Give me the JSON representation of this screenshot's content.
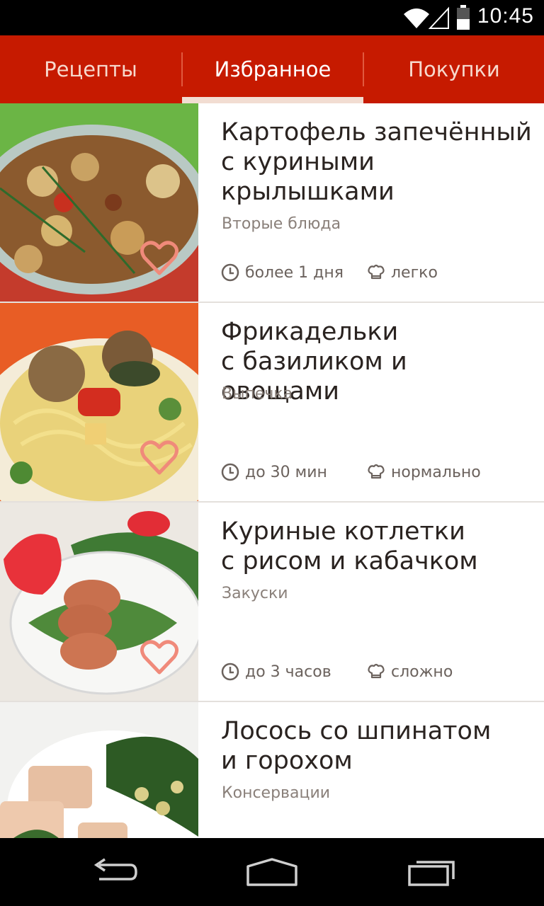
{
  "status": {
    "time": "10:45"
  },
  "tabs": [
    {
      "label": "Рецепты",
      "active": false
    },
    {
      "label": "Избранное",
      "active": true
    },
    {
      "label": "Покупки",
      "active": false
    }
  ],
  "recipes": [
    {
      "title": "Картофель запечённый\nс куриными\nкрылышками",
      "category": "Вторые блюда",
      "time": "более 1 дня",
      "difficulty": "легко",
      "favorite": true
    },
    {
      "title": "Фрикадельки\nс базиликом и овощами",
      "category": "Выпечка",
      "time": "до 30 мин",
      "difficulty": "нормально",
      "favorite": true
    },
    {
      "title": "Куриные котлетки\nс рисом и кабачком",
      "category": "Закуски",
      "time": "до 3 часов",
      "difficulty": "сложно",
      "favorite": true
    },
    {
      "title": "Лосось со шпинатом\nи горохом",
      "category": "Консервации"
    }
  ],
  "icons": {
    "wifi": "wifi-icon",
    "signal": "signal-icon",
    "battery": "battery-icon",
    "clock": "clock-icon",
    "chef_hat": "chef-hat-icon",
    "heart": "heart-icon",
    "back": "back-icon",
    "home": "home-icon",
    "recent": "recent-apps-icon"
  },
  "colors": {
    "accent": "#c61a00",
    "heart": "#f08a7a",
    "text": "#2a2320",
    "muted": "#8a807a"
  }
}
